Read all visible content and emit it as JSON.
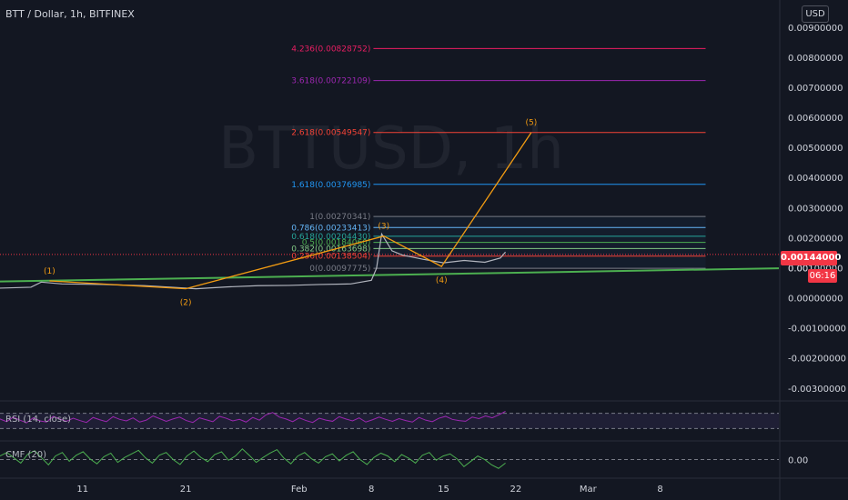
{
  "header": {
    "symbol_title": "BTT / Dollar, 1h, BITFINEX",
    "watermark": "BTTUSD, 1h",
    "currency_button": "USD",
    "last_price": "0.00144000",
    "bar_countdown": "06:16"
  },
  "colors": {
    "background": "#131722",
    "price_line": "#b2b5be",
    "wave": "#f39c12",
    "trendline": "#4caf50",
    "rsi": "#9c27b0",
    "cmf": "#4caf50",
    "last_price": "#f23645"
  },
  "chart_data": [
    {
      "type": "line",
      "pane": "main",
      "y_axis_ticks": [
        "0.00900000",
        "0.00800000",
        "0.00700000",
        "0.00600000",
        "0.00500000",
        "0.00400000",
        "0.00300000",
        "0.00200000",
        "0.00100000",
        "0.00000000",
        "-0.00100000",
        "-0.00200000",
        "-0.00300000"
      ],
      "y_axis_partial_label": "0.001",
      "ylim": [
        -0.0034,
        0.0099
      ],
      "x_axis_ticks": [
        {
          "label": "11",
          "day": 11
        },
        {
          "label": "21",
          "day": 21
        },
        {
          "label": "Feb",
          "day": 32
        },
        {
          "label": "8",
          "day": 39
        },
        {
          "label": "15",
          "day": 46
        },
        {
          "label": "22",
          "day": 53
        },
        {
          "label": "Mar",
          "day": 60
        },
        {
          "label": "8",
          "day": 67
        }
      ],
      "xlim_day": [
        3.0,
        78.5
      ],
      "price_series": {
        "name": "BTTUSD",
        "points": [
          [
            3,
            0.00032
          ],
          [
            6,
            0.00035
          ],
          [
            7,
            0.00052
          ],
          [
            9,
            0.00046
          ],
          [
            13,
            0.00044
          ],
          [
            17,
            0.0004
          ],
          [
            20,
            0.00034
          ],
          [
            22,
            0.0003
          ],
          [
            25,
            0.00036
          ],
          [
            28,
            0.0004
          ],
          [
            31,
            0.00041
          ],
          [
            34,
            0.00044
          ],
          [
            37,
            0.00046
          ],
          [
            39,
            0.00058
          ],
          [
            39.5,
            0.00098
          ],
          [
            40,
            0.00212
          ],
          [
            41,
            0.00156
          ],
          [
            42,
            0.00142
          ],
          [
            44,
            0.00128
          ],
          [
            46,
            0.00116
          ],
          [
            48,
            0.00124
          ],
          [
            50,
            0.00118
          ],
          [
            51.5,
            0.00132
          ],
          [
            52,
            0.00152
          ]
        ]
      },
      "elliott_wave": {
        "points": [
          {
            "label": "(1)",
            "day": 7.8,
            "value": 0.00056
          },
          {
            "label": "(2)",
            "day": 21.0,
            "value": 0.0003
          },
          {
            "label": "(3)",
            "day": 40.2,
            "value": 0.00205
          },
          {
            "label": "(4)",
            "day": 45.8,
            "value": 0.00104
          },
          {
            "label": "(5)",
            "day": 54.5,
            "value": 0.00549547
          }
        ]
      },
      "fibonacci": {
        "levels": [
          {
            "label": "4.236(0.00828752)",
            "value": 0.00828752,
            "color": "#e91e63"
          },
          {
            "label": "3.618(0.00722109)",
            "value": 0.00722109,
            "color": "#9c27b0"
          },
          {
            "label": "2.618(0.00549547)",
            "value": 0.00549547,
            "color": "#f44336"
          },
          {
            "label": "1.618(0.00376985)",
            "value": 0.00376985,
            "color": "#2196f3"
          },
          {
            "label": "1(0.00270341)",
            "value": 0.00270341,
            "color": "#787b86"
          },
          {
            "label": "0.786(0.00233413)",
            "value": 0.00233413,
            "color": "#64b5f6"
          },
          {
            "label": "0.618(0.00204430)",
            "value": 0.0020443,
            "color": "#26a69a"
          },
          {
            "label": "0.5(0.00184060)",
            "value": 0.0018406,
            "color": "#4caf50"
          },
          {
            "label": "0.382(0.00163698)",
            "value": 0.00163698,
            "color": "#81c784"
          },
          {
            "label": "0.236(0.00138504)",
            "value": 0.00138504,
            "color": "#f44336"
          },
          {
            "label": "0(0.00097775)",
            "value": 0.00097775,
            "color": "#787b86"
          }
        ]
      },
      "trendline": {
        "from": [
          3,
          0.00054
        ],
        "to": [
          78.5,
          0.00098
        ]
      },
      "last_price_value": 0.00144
    },
    {
      "type": "line",
      "pane": "rsi",
      "title": "RSI (14, close)",
      "ylim": [
        0,
        100
      ],
      "bands": [
        70,
        30
      ],
      "series": {
        "x_range_day": [
          3,
          52
        ],
        "values": [
          55,
          48,
          60,
          52,
          45,
          58,
          50,
          47,
          62,
          55,
          49,
          57,
          51,
          46,
          59,
          53,
          48,
          61,
          54,
          50,
          58,
          47,
          52,
          63,
          56,
          49,
          55,
          60,
          51,
          46,
          58,
          53,
          48,
          62,
          57,
          50,
          54,
          47,
          59,
          52,
          66,
          72,
          60,
          55,
          48,
          58,
          51,
          46,
          57,
          52,
          49,
          61,
          55,
          50,
          58,
          47,
          53,
          60,
          54,
          49,
          56,
          51,
          47,
          59,
          52,
          48,
          57,
          62,
          54,
          51,
          49,
          60,
          56,
          63,
          58,
          66,
          75
        ]
      },
      "color": "#9c27b0"
    },
    {
      "type": "line",
      "pane": "cmf",
      "title": "CMF (20)",
      "y_axis_ticks": [
        "0.00"
      ],
      "ylim": [
        -0.5,
        0.5
      ],
      "series": {
        "x_range_day": [
          3,
          52
        ],
        "values": [
          0.1,
          0.2,
          0.05,
          -0.1,
          0.15,
          0.25,
          0.05,
          -0.15,
          0.1,
          0.2,
          -0.05,
          0.12,
          0.22,
          0.02,
          -0.12,
          0.08,
          0.18,
          -0.08,
          0.06,
          0.16,
          0.26,
          0.05,
          -0.1,
          0.12,
          0.2,
          0.0,
          -0.14,
          0.1,
          0.24,
          0.06,
          -0.06,
          0.14,
          0.22,
          -0.02,
          0.1,
          0.3,
          0.12,
          -0.08,
          0.06,
          0.18,
          0.28,
          0.04,
          -0.12,
          0.1,
          0.2,
          0.02,
          -0.1,
          0.08,
          0.16,
          -0.04,
          0.12,
          0.22,
          0.0,
          -0.14,
          0.06,
          0.18,
          0.1,
          -0.06,
          0.14,
          0.04,
          -0.1,
          0.12,
          0.2,
          -0.02,
          0.1,
          0.16,
          0.02,
          -0.2,
          -0.05,
          0.1,
          0.0,
          -0.15,
          -0.25,
          -0.1
        ]
      },
      "color": "#4caf50"
    }
  ]
}
